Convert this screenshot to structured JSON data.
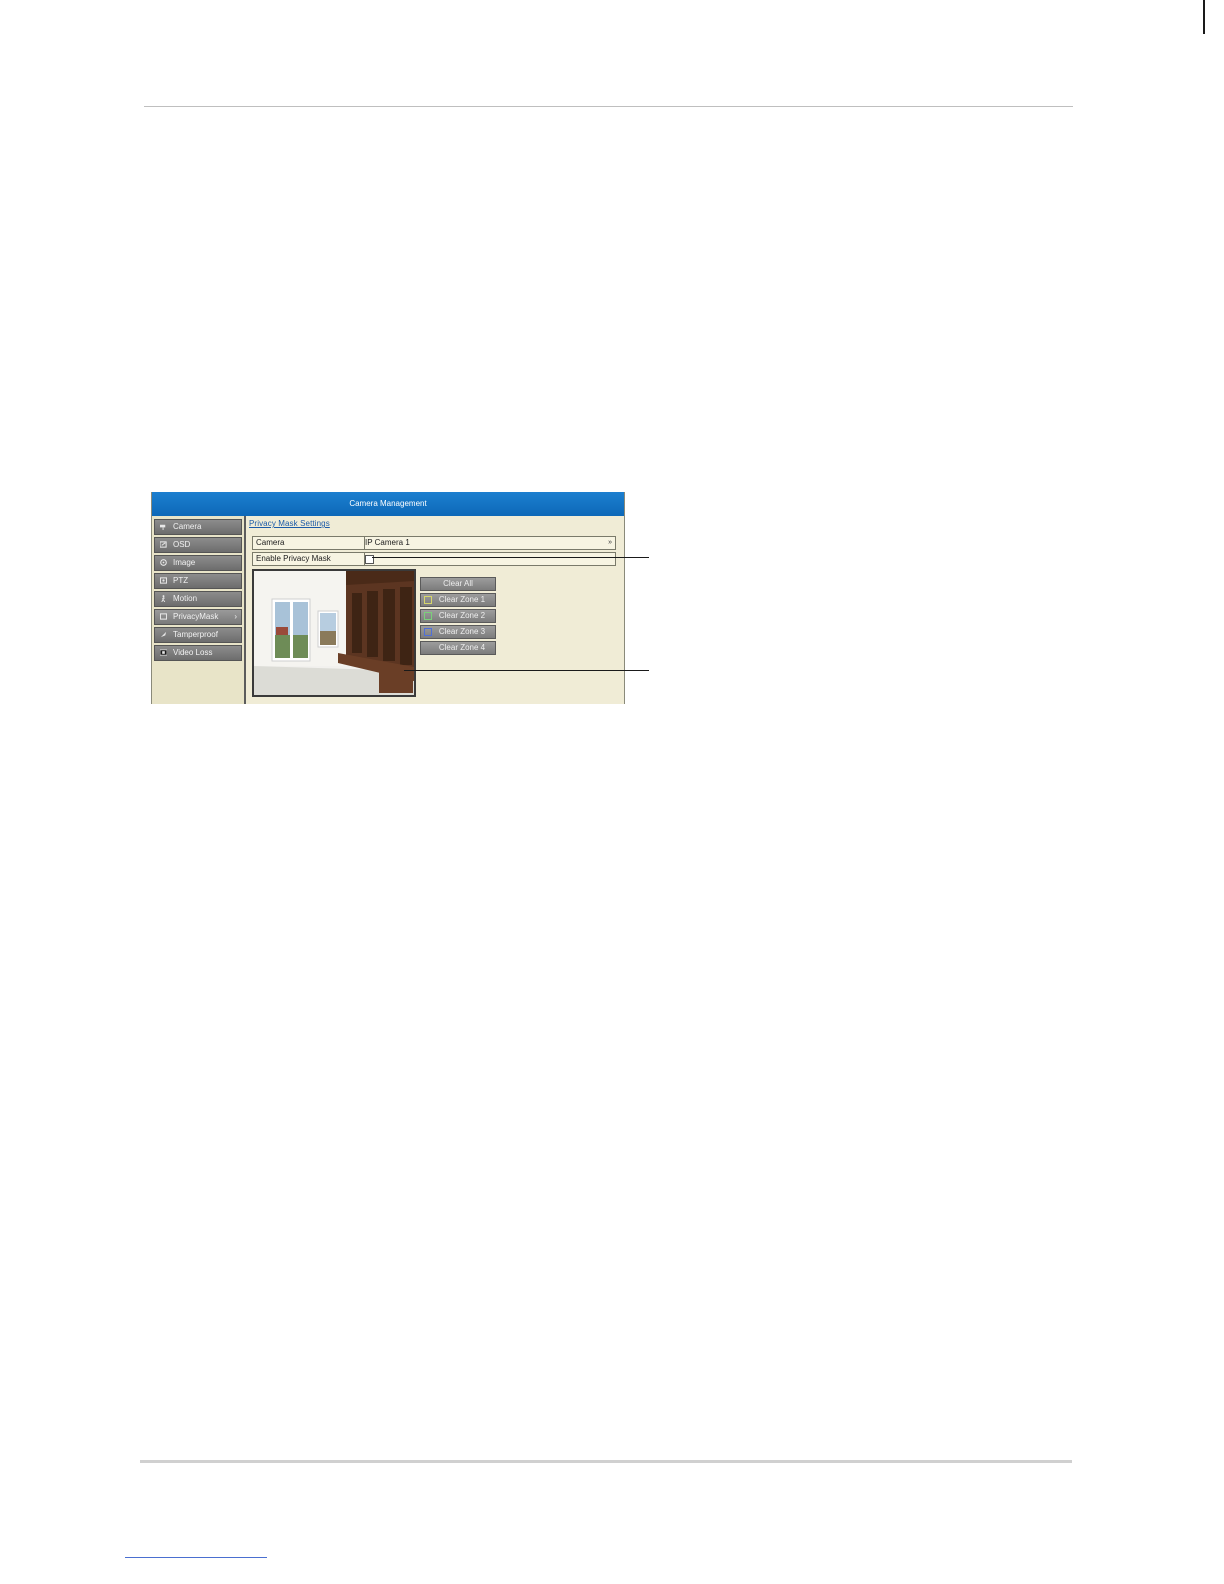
{
  "window": {
    "title": "Camera Management"
  },
  "sidebar": {
    "items": [
      {
        "label": "Camera",
        "icon": "camera-icon"
      },
      {
        "label": "OSD",
        "icon": "osd-icon"
      },
      {
        "label": "Image",
        "icon": "image-icon"
      },
      {
        "label": "PTZ",
        "icon": "ptz-icon"
      },
      {
        "label": "Motion",
        "icon": "motion-icon"
      },
      {
        "label": "PrivacyMask",
        "icon": "privacy-mask-icon",
        "active": true,
        "arrow": "›"
      },
      {
        "label": "Tamperproof",
        "icon": "tamperproof-icon"
      },
      {
        "label": "Video Loss",
        "icon": "video-loss-icon"
      }
    ]
  },
  "main": {
    "section_title": "Privacy Mask Settings",
    "camera_row": {
      "label": "Camera",
      "value": "IP Camera 1",
      "arrow": "»"
    },
    "enable_row": {
      "label": "Enable Privacy Mask",
      "checked": false
    },
    "buttons": {
      "clear_all": "Clear All",
      "zones": [
        {
          "label": "Clear Zone 1",
          "color": "#d6d66a"
        },
        {
          "label": "Clear Zone 2",
          "color": "#7ad07a"
        },
        {
          "label": "Clear Zone 3",
          "color": "#4f6fd8"
        },
        {
          "label": "Clear Zone 4",
          "color": "#d0d0d0"
        }
      ]
    }
  },
  "colors": {
    "title_bar": "#0d68b8",
    "panel_bg": "#f0ecd6",
    "menu_item": "#7a7a7a",
    "link": "#1a5aa8"
  }
}
